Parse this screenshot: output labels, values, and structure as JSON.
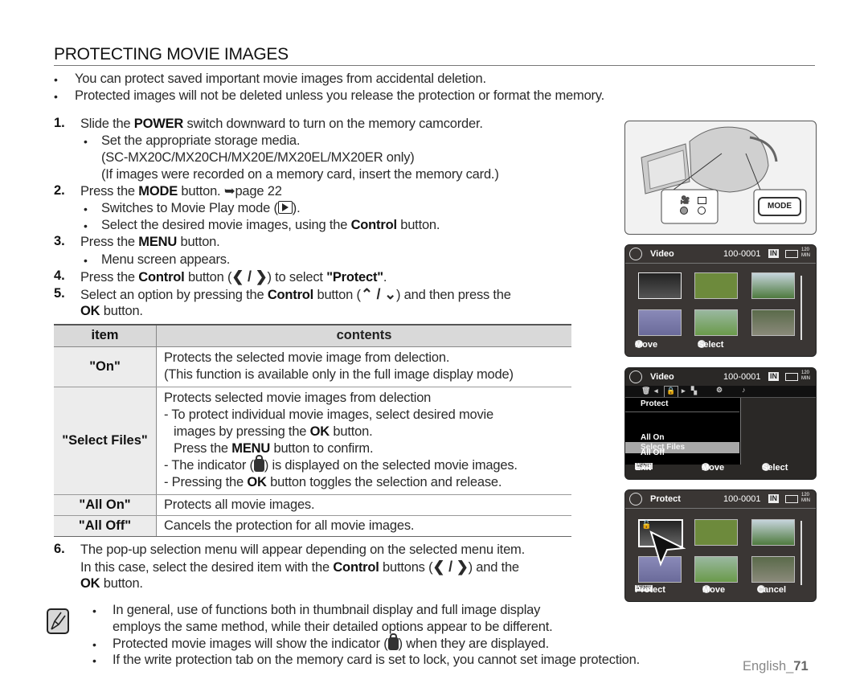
{
  "page": {
    "title": "PROTECTING MOVIE IMAGES",
    "intro_bullets": [
      "You can protect saved important movie images from accidental deletion.",
      "Protected images will not be deleted unless you release the protection or format the memory."
    ],
    "steps": {
      "s1": {
        "num": "1.",
        "pre": "Slide the ",
        "bold": "POWER",
        "post": " switch downward to turn on the memory camcorder."
      },
      "s1_b1": "Set the appropriate storage media.",
      "s1_b1_l2": "(SC-MX20C/MX20CH/MX20E/MX20EL/MX20ER only)",
      "s1_b1_l3": "(If images were recorded on a memory card, insert the memory card.)",
      "s2": {
        "num": "2.",
        "pre": "Press the ",
        "bold": "MODE",
        "post": " button. ➥page 22"
      },
      "s2_b1": {
        "pre": "Switches to Movie Play mode (",
        "post": ")."
      },
      "s2_b2": {
        "pre": "Select the desired movie images, using the ",
        "bold": "Control",
        "post": " button."
      },
      "s3": {
        "num": "3.",
        "pre": "Press the ",
        "bold": "MENU",
        "post": " button."
      },
      "s3_b1": "Menu screen appears.",
      "s4": {
        "num": "4.",
        "pre": "Press the ",
        "bold": "Control",
        "mid": " button (",
        "chev": "❮ / ❯",
        "post": ") to select ",
        "bold2": "\"Protect\"",
        "end": "."
      },
      "s5": {
        "num": "5.",
        "pre": "Select an option by pressing the ",
        "bold": "Control",
        "mid": " button (",
        "chev": "⌃ / ⌄",
        "post": ") and then press the"
      },
      "s5_l2": {
        "bold": "OK",
        "post": " button."
      },
      "s6": {
        "num": "6.",
        "text": "The pop-up selection menu will appear depending on the selected menu item."
      },
      "s6_l2": {
        "pre": "In this case, select the desired item with the ",
        "bold": "Control",
        "mid": " buttons (",
        "chev": "❮ / ❯",
        "post": ")  and the"
      },
      "s6_l3": {
        "bold": "OK",
        "post": " button."
      }
    },
    "table": {
      "headers": [
        "item",
        "contents"
      ],
      "rows": [
        {
          "item": "\"On\"",
          "lines": [
            "Protects the selected movie image from delection.",
            "(This function is available only in the full image display mode)"
          ]
        },
        {
          "item": "\"Select Files\"",
          "l1": "Protects selected movie images from delection",
          "l2": "- To protect individual movie images, select desired movie",
          "l3_pre": "images by pressing the ",
          "l3_bold": "OK",
          "l3_post": " button.",
          "l4_pre": "Press the ",
          "l4_bold": "MENU",
          "l4_post": " button to confirm.",
          "l5_pre": "- The indicator (",
          "l5_post": ") is displayed on the selected movie images.",
          "l6_pre": "- Pressing the ",
          "l6_bold": "OK",
          "l6_post": " button toggles the selection and release."
        },
        {
          "item": "\"All On\"",
          "lines": [
            "Protects all movie images."
          ]
        },
        {
          "item": "\"All Off\"",
          "lines": [
            "Cancels the protection for all movie images."
          ]
        }
      ]
    },
    "notes": {
      "n1_l1": "In general, use of functions both in thumbnail display and full image display",
      "n1_l2": "employs the same method, while their detailed options appear to be different.",
      "n2_pre": "Protected movie images will show the indicator (",
      "n2_post": ") when they are displayed.",
      "n3": "If the write protection tab on the memory card is set to lock, you cannot set image protection."
    },
    "footer": {
      "lang": "English_",
      "page": "71"
    }
  },
  "illustrations": {
    "camcorder": {
      "mode_button": "MODE",
      "icons": [
        "movie-camera-icon",
        "play-icon"
      ]
    },
    "screen1": {
      "title": "Video",
      "file_no": "100-0001",
      "storage": "IN",
      "time_top": "120",
      "time_bottom": "MIN",
      "foot": [
        "Move",
        "Select"
      ]
    },
    "screen2": {
      "title": "Video",
      "file_no": "100-0001",
      "storage": "IN",
      "time_top": "120",
      "time_bottom": "MIN",
      "menu_title": "Protect",
      "menu_items": [
        "Select Files",
        "All On",
        "All Off"
      ],
      "selected": "Select Files",
      "foot_tag": "MENU",
      "foot": [
        "Exit",
        "Move",
        "Select"
      ]
    },
    "screen3": {
      "title": "Protect",
      "file_no": "100-0001",
      "storage": "IN",
      "time_top": "120",
      "time_bottom": "MIN",
      "foot_tag": "MENU",
      "foot": [
        "Protect",
        "Move",
        "Cancel"
      ]
    }
  }
}
